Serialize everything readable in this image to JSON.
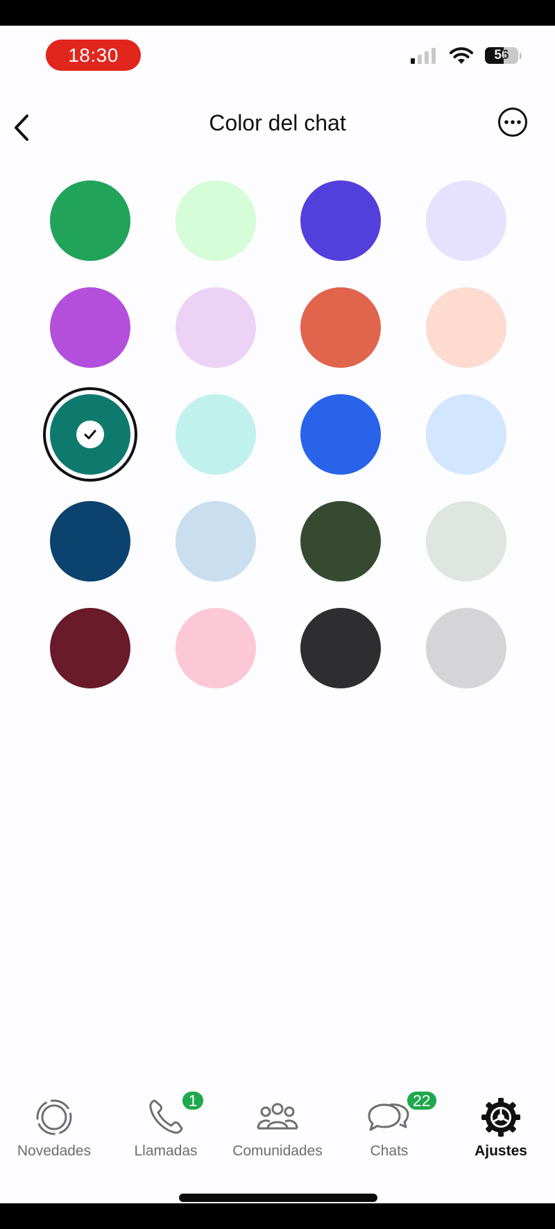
{
  "status_bar": {
    "time": "18:30",
    "battery_level": "56",
    "icons": [
      "signal-icon",
      "wifi-icon",
      "battery-icon"
    ]
  },
  "header": {
    "title": "Color del chat",
    "back_icon": "chevron-left-icon",
    "more_icon": "more-options-icon"
  },
  "colors": {
    "rows": [
      [
        "#21a359",
        "#d5fdd7",
        "#5340dc",
        "#e6e2fd"
      ],
      [
        "#b44fdc",
        "#ecd3f6",
        "#e1644d",
        "#fddbd0"
      ],
      [
        "#0e7a6e",
        "#c1f1ec",
        "#2963ea",
        "#d2e6fe"
      ],
      [
        "#0c426e",
        "#c9deee",
        "#354a31",
        "#dfe5df"
      ],
      [
        "#691a2b",
        "#fcc8d6",
        "#2e2e31",
        "#d5d5d8"
      ]
    ],
    "selected": [
      2,
      0
    ]
  },
  "tab_bar": {
    "tabs": [
      {
        "label": "Novedades",
        "icon": "status-updates-icon",
        "badge": "",
        "active": false
      },
      {
        "label": "Llamadas",
        "icon": "phone-icon",
        "badge": "1",
        "active": false
      },
      {
        "label": "Comunidades",
        "icon": "communities-icon",
        "badge": "",
        "active": false
      },
      {
        "label": "Chats",
        "icon": "chat-bubbles-icon",
        "badge": "22",
        "active": false
      },
      {
        "label": "Ajustes",
        "icon": "settings-gear-icon",
        "badge": "",
        "active": true
      }
    ]
  }
}
